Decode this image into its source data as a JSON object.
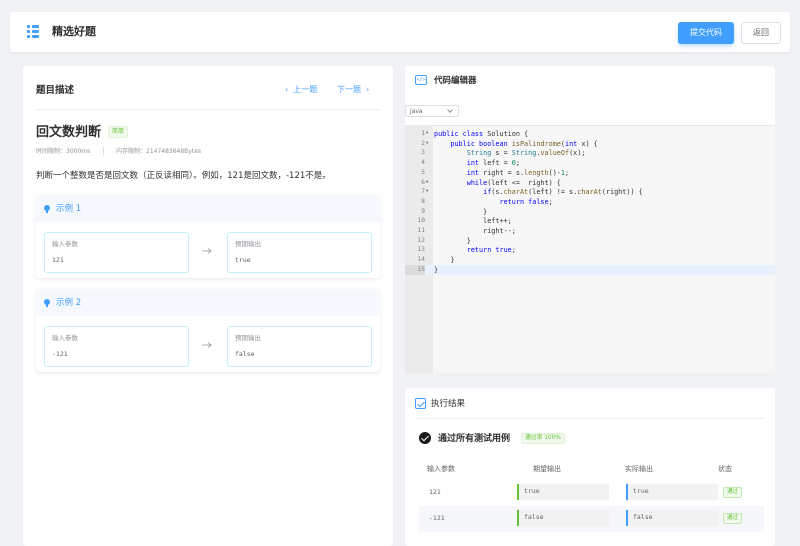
{
  "header": {
    "title": "精选好题",
    "submit_label": "提交代码",
    "back_label": "返回"
  },
  "problem": {
    "section_title": "题目描述",
    "prev_label": "上一题",
    "next_label": "下一题",
    "title": "回文数判断",
    "difficulty": "简单",
    "time_limit": "时间限制：3000ms",
    "memory_limit": "内存限制：2147483648Bytes",
    "description": "判断一个整数是否是回文数（正反读相同）。例如，121是回文数，-121不是。",
    "examples": [
      {
        "title": "示例 1",
        "input_label": "输入参数",
        "input": "121",
        "output_label": "预期输出",
        "output": "true"
      },
      {
        "title": "示例 2",
        "input_label": "输入参数",
        "input": "-121",
        "output_label": "预期输出",
        "output": "false"
      }
    ]
  },
  "editor": {
    "title": "代码编辑器",
    "language": "java",
    "icon": "code-icon",
    "active_line": 15,
    "lines": [
      "public class Solution {",
      "    public boolean isPalindrome(int x) {",
      "        String s = String.valueOf(x);",
      "        int left = 0;",
      "        int right = s.length()-1;",
      "        while(left <=  right) {",
      "            if(s.charAt(left) != s.charAt(right)) {",
      "                return false;",
      "            }",
      "            left++;",
      "            right--;",
      "        }",
      "        return true;",
      "    }",
      "}"
    ]
  },
  "result": {
    "title": "执行结果",
    "summary": "通过所有测试用例",
    "pass_rate": "通过率 100%",
    "columns": [
      "输入参数",
      "期望输出",
      "实际输出",
      "状态"
    ],
    "rows": [
      {
        "input": "121",
        "expected": "true",
        "actual": "true",
        "status": "通过"
      },
      {
        "input": "-121",
        "expected": "false",
        "actual": "false",
        "status": "通过"
      }
    ]
  },
  "colors": {
    "primary": "#409eff",
    "success": "#67c23a"
  }
}
